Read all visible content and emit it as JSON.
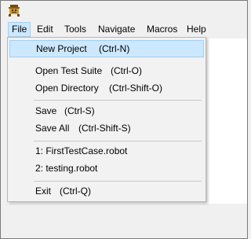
{
  "menubar": {
    "items": [
      "File",
      "Edit",
      "Tools",
      "Navigate",
      "Macros",
      "Help"
    ],
    "active": "File"
  },
  "file_menu": {
    "new_project": {
      "label": "New Project",
      "shortcut": "(Ctrl-N)"
    },
    "open_test_suite": {
      "label": "Open Test Suite",
      "shortcut": "(Ctrl-O)"
    },
    "open_directory": {
      "label": "Open Directory",
      "shortcut": "(Ctrl-Shift-O)"
    },
    "save": {
      "label": "Save",
      "shortcut": "(Ctrl-S)"
    },
    "save_all": {
      "label": "Save All",
      "shortcut": "(Ctrl-Shift-S)"
    },
    "recent_1": {
      "label": "1: FirstTestCase.robot"
    },
    "recent_2": {
      "label": "2: testing.robot"
    },
    "exit": {
      "label": "Exit",
      "shortcut": "(Ctrl-Q)"
    }
  },
  "colors": {
    "highlight": "#cce8ff",
    "highlight_border": "#99d1ff",
    "menu_bg": "#f2f2f2"
  },
  "icons": {
    "app": "app-icon"
  }
}
